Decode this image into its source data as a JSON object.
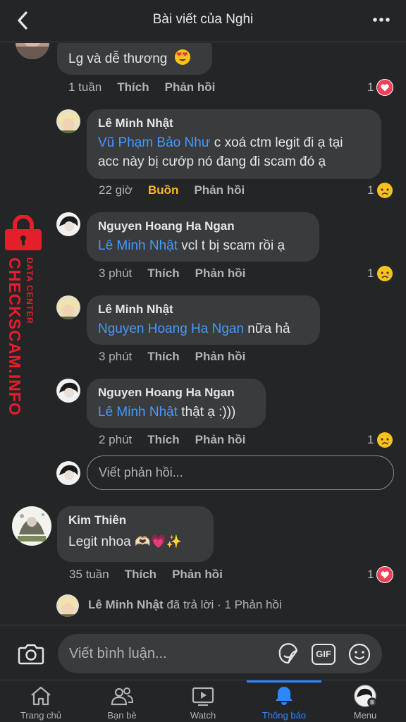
{
  "header": {
    "title": "Bài viết của Nghi"
  },
  "colors": {
    "accent": "#2d88ff",
    "mention": "#4599ff",
    "sad_reaction": "#f7b928",
    "love": "#f33e58",
    "watermark": "#e41e2b"
  },
  "watermark": {
    "line1": "DATA CENTER",
    "line2": "CHECKSCAM.INFO"
  },
  "comments": [
    {
      "text": "Lg và dễ thương",
      "emoji_icon": "heart-eyes-emoji",
      "time": "1 tuần",
      "like": "Thích",
      "reply": "Phản hồi",
      "reaction_count": "1",
      "reaction_icon": "love-reaction-icon"
    },
    {
      "name": "Lê Minh Nhật",
      "mention": "Vũ Phạm Bảo Như",
      "text_line1": " c xoá ctm legit đi ạ tại",
      "text_line2": "acc này bị cướp nó đang đi scam đó ạ",
      "time": "22 giờ",
      "like": "Buồn",
      "reply": "Phản hồi",
      "reaction_count": "1",
      "reaction_icon": "sad-reaction-icon"
    },
    {
      "name": "Nguyen Hoang Ha Ngan",
      "mention": "Lê Minh Nhật",
      "text": " vcl t bị scam rồi ạ",
      "time": "3 phút",
      "like": "Thích",
      "reply": "Phản hồi",
      "reaction_count": "1",
      "reaction_icon": "sad-reaction-icon"
    },
    {
      "name": "Lê Minh Nhật",
      "mention": "Nguyen Hoang Ha Ngan",
      "text": " nữa hả",
      "time": "3 phút",
      "like": "Thích",
      "reply": "Phản hồi"
    },
    {
      "name": "Nguyen Hoang Ha Ngan",
      "mention": "Lê Minh Nhật",
      "text": " thật ạ :)))",
      "time": "2 phút",
      "like": "Thích",
      "reply": "Phản hồi",
      "reaction_count": "1",
      "reaction_icon": "sad-reaction-icon"
    },
    {
      "name": "Kim Thiên",
      "text": "Legit nhoa",
      "emojis": "🫶🏻💗✨",
      "time": "35 tuần",
      "like": "Thích",
      "reply": "Phản hồi",
      "reaction_count": "1",
      "reaction_icon": "love-reaction-icon"
    }
  ],
  "reply_box": {
    "placeholder": "Viết phản hồi..."
  },
  "replied_summary": {
    "name": "Lê Minh Nhật",
    "action": " đã trả lời",
    "dot": " · ",
    "count": "1 Phản hồi"
  },
  "composer": {
    "placeholder": "Viết bình luận...",
    "gif": "GIF"
  },
  "tabs": [
    {
      "label": "Trang chủ",
      "icon": "home-icon"
    },
    {
      "label": "Bạn bè",
      "icon": "friends-icon"
    },
    {
      "label": "Watch",
      "icon": "watch-icon"
    },
    {
      "label": "Thông báo",
      "icon": "bell-icon",
      "active": true
    },
    {
      "label": "Menu",
      "icon": "profile-avatar-icon"
    }
  ]
}
